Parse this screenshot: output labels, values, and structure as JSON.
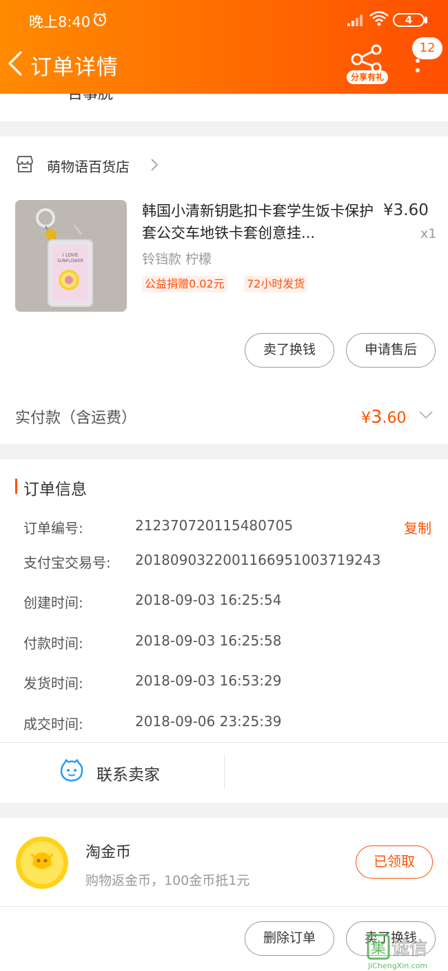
{
  "status_bar": {
    "time": "晚上8:40",
    "battery": "4"
  },
  "header": {
    "title": "订单详情",
    "share_label": "分享有礼",
    "message_count": "12"
  },
  "partial_top_text": "百事脱",
  "shop": {
    "name": "萌物语百货店"
  },
  "product": {
    "title": "韩国小清新钥匙扣卡套学生饭卡保护套公交车地铁卡套创意挂...",
    "price": "¥3.60",
    "quantity": "x1",
    "sku": "铃铛款 柠檬",
    "tags": [
      "公益捐赠0.02元",
      "72小时发货"
    ],
    "image_text": "I LOVE SUNFLOWER"
  },
  "item_actions": {
    "sell_label": "卖了换钱",
    "after_sale_label": "申请售后"
  },
  "payment": {
    "label": "实付款（含运费）",
    "currency": "¥",
    "amount_int": "3",
    "amount_dec": ".60"
  },
  "order_info": {
    "title": "订单信息",
    "copy_label": "复制",
    "rows": [
      {
        "label": "订单编号:",
        "value": "212370720115480705"
      },
      {
        "label": "支付宝交易号:",
        "value": "2018090322001166951003719243"
      },
      {
        "label": "创建时间:",
        "value": "2018-09-03 16:25:54"
      },
      {
        "label": "付款时间:",
        "value": "2018-09-03 16:25:58"
      },
      {
        "label": "发货时间:",
        "value": "2018-09-03 16:53:29"
      },
      {
        "label": "成交时间:",
        "value": "2018-09-06 23:25:39"
      }
    ]
  },
  "contact": {
    "label": "联系卖家"
  },
  "coins": {
    "title": "淘金币",
    "desc": "购物返金币，100金币抵1元",
    "button_label": "已领取"
  },
  "bottom_actions": {
    "delete_label": "删除订单",
    "sell_label": "卖了换钱"
  },
  "watermark": {
    "text": "JiChengXin.com",
    "chars": "集诚信"
  },
  "colors": {
    "accent": "#ff5000",
    "header_start": "#ff8a00",
    "header_end": "#ff4f00"
  }
}
